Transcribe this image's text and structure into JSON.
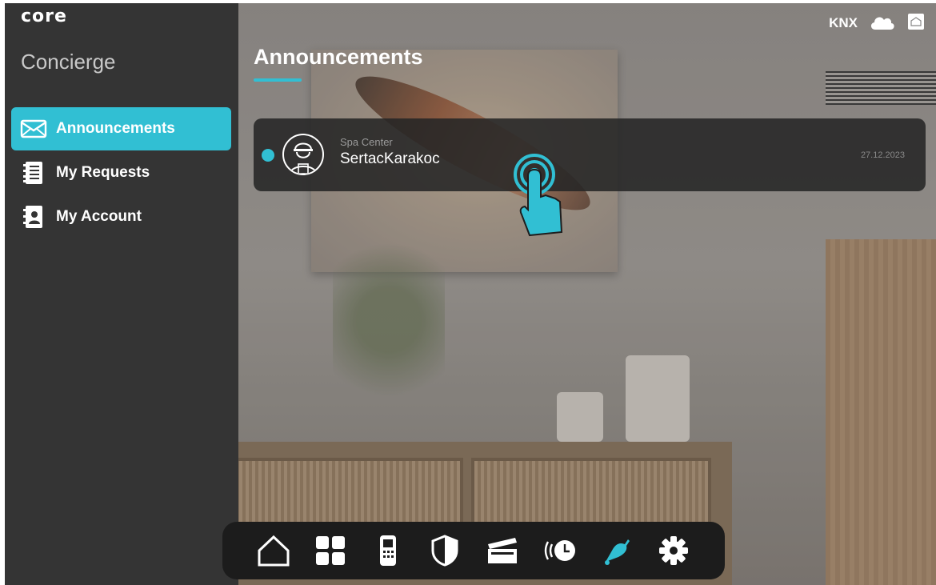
{
  "app": {
    "logo": "core",
    "section": "Concierge"
  },
  "sidebar": {
    "items": [
      {
        "label": "Announcements",
        "icon": "envelope-icon",
        "active": true
      },
      {
        "label": "My Requests",
        "icon": "notebook-list-icon",
        "active": false
      },
      {
        "label": "My Account",
        "icon": "contact-book-icon",
        "active": false
      }
    ]
  },
  "header": {
    "title": "Announcements",
    "status": {
      "protocol": "KNX",
      "cloud_icon": "cloud-icon",
      "home_icon": "home-box-icon"
    }
  },
  "announcements": [
    {
      "category": "Spa Center",
      "sender": "SertacKarakoc",
      "date": "27.12.2023",
      "unread": true,
      "avatar_icon": "worker-avatar-icon"
    }
  ],
  "dock": {
    "items": [
      {
        "icon": "home-icon",
        "active": false
      },
      {
        "icon": "grid-icon",
        "active": false
      },
      {
        "icon": "intercom-icon",
        "active": false
      },
      {
        "icon": "shield-icon",
        "active": false
      },
      {
        "icon": "clapperboard-icon",
        "active": false
      },
      {
        "icon": "schedule-icon",
        "active": false
      },
      {
        "icon": "concierge-bell-icon",
        "active": true
      },
      {
        "icon": "gear-icon",
        "active": false
      }
    ]
  },
  "colors": {
    "accent": "#31bfd3",
    "sidebar": "#343434",
    "card": "#262626",
    "dock": "#1c1c1c"
  }
}
